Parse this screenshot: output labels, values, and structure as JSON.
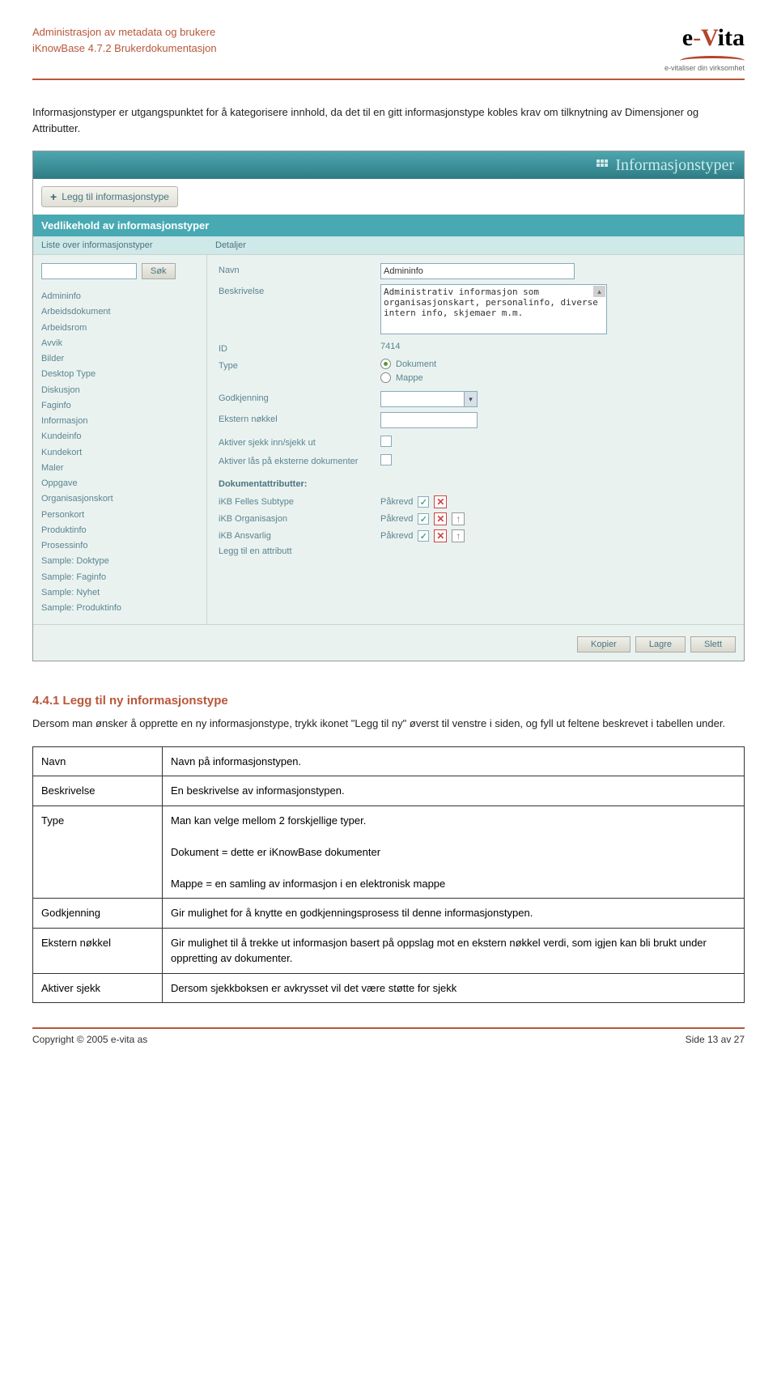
{
  "header": {
    "line1": "Administrasjon av metadata og brukere",
    "line2": "iKnowBase 4.7.2 Brukerdokumentasjon",
    "logo_tagline": "e-vitaliser din virksomhet"
  },
  "intro": "Informasjonstyper er utgangspunktet for å kategorisere innhold, da det til en gitt informasjonstype kobles krav om tilknytning av Dimensjoner og Attributter.",
  "app": {
    "title": "Informasjonstyper",
    "add_button": "Legg til informasjonstype",
    "panel_header": "Vedlikehold av informasjonstyper",
    "tab_left": "Liste over informasjonstyper",
    "tab_right": "Detaljer",
    "search_button": "Søk",
    "list": [
      "Admininfo",
      "Arbeidsdokument",
      "Arbeidsrom",
      "Avvik",
      "Bilder",
      "Desktop Type",
      "Diskusjon",
      "Faginfo",
      "Informasjon",
      "Kundeinfo",
      "Kundekort",
      "Maler",
      "Oppgave",
      "Organisasjonskort",
      "Personkort",
      "Produktinfo",
      "Prosessinfo",
      "Sample: Doktype",
      "Sample: Faginfo",
      "Sample: Nyhet",
      "Sample: Produktinfo"
    ],
    "fields": {
      "navn_label": "Navn",
      "navn_value": "Admininfo",
      "beskrivelse_label": "Beskrivelse",
      "beskrivelse_value": "Administrativ informasjon som organisasjonskart, personalinfo, diverse intern info, skjemaer m.m.",
      "id_label": "ID",
      "id_value": "7414",
      "type_label": "Type",
      "type_opt1": "Dokument",
      "type_opt2": "Mappe",
      "godkjenning_label": "Godkjenning",
      "ekstern_label": "Ekstern nøkkel",
      "aktiver_sjekk_label": "Aktiver sjekk inn/sjekk ut",
      "aktiver_las_label": "Aktiver lås på eksterne dokumenter"
    },
    "attr_header": "Dokumentattributter:",
    "attrs": {
      "a1": "iKB Felles Subtype",
      "a2": "iKB Organisasjon",
      "a3": "iKB Ansvarlig",
      "add": "Legg til en attributt",
      "req": "Påkrevd"
    },
    "buttons": {
      "kopier": "Kopier",
      "lagre": "Lagre",
      "slett": "Slett"
    }
  },
  "section": {
    "heading": "4.4.1  Legg til ny informasjonstype",
    "para": "Dersom man ønsker å opprette en ny informasjonstype, trykk ikonet \"Legg til ny\" øverst til venstre i siden, og fyll ut feltene beskrevet i tabellen under."
  },
  "table": {
    "r1c1": "Navn",
    "r1c2": "Navn på informasjonstypen.",
    "r2c1": "Beskrivelse",
    "r2c2": "En beskrivelse av informasjonstypen.",
    "r3c1": "Type",
    "r3c2a": "Man kan velge mellom 2 forskjellige typer.",
    "r3c2b": "Dokument = dette er iKnowBase dokumenter",
    "r3c2c": "Mappe = en samling av informasjon i en elektronisk mappe",
    "r4c1": "Godkjenning",
    "r4c2": "Gir mulighet for å knytte en godkjenningsprosess til denne informasjonstypen.",
    "r5c1": "Ekstern nøkkel",
    "r5c2": "Gir mulighet til å trekke ut informasjon basert på oppslag mot en ekstern nøkkel verdi, som igjen kan bli brukt under oppretting av dokumenter.",
    "r6c1": "Aktiver sjekk",
    "r6c2": "Dersom sjekkboksen er avkrysset vil det være støtte for sjekk"
  },
  "footer": {
    "left": "Copyright © 2005 e-vita as",
    "right": "Side 13 av 27"
  }
}
